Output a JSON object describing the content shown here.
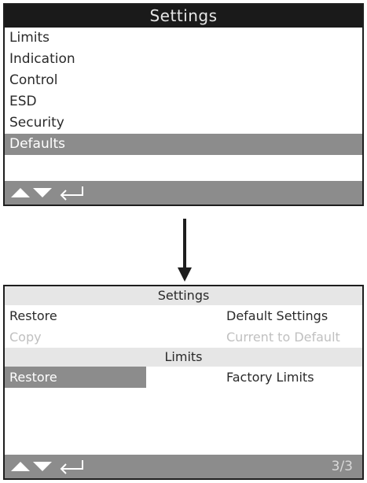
{
  "screen1": {
    "title": "Settings",
    "menu_items": [
      "Limits",
      "Indication",
      "Control",
      "ESD",
      "Security",
      "Defaults"
    ],
    "selected_index": 5
  },
  "screen2": {
    "header1": "Settings",
    "rows1": [
      {
        "left": "Restore",
        "right": "Default Settings",
        "enabled": true
      },
      {
        "left": "Copy",
        "right": "Current to Default",
        "enabled": false
      }
    ],
    "header2": "Limits",
    "rows2": [
      {
        "left": "Restore",
        "right": "Factory Limits",
        "selected": true
      }
    ],
    "page": "3/3"
  },
  "icons": {
    "up": "up-arrow-icon",
    "down": "down-arrow-icon",
    "enter": "enter-icon"
  },
  "colors": {
    "title_bg": "#1a1a1a",
    "selection_bg": "#8c8c8c",
    "band_bg": "#e6e6e6"
  }
}
